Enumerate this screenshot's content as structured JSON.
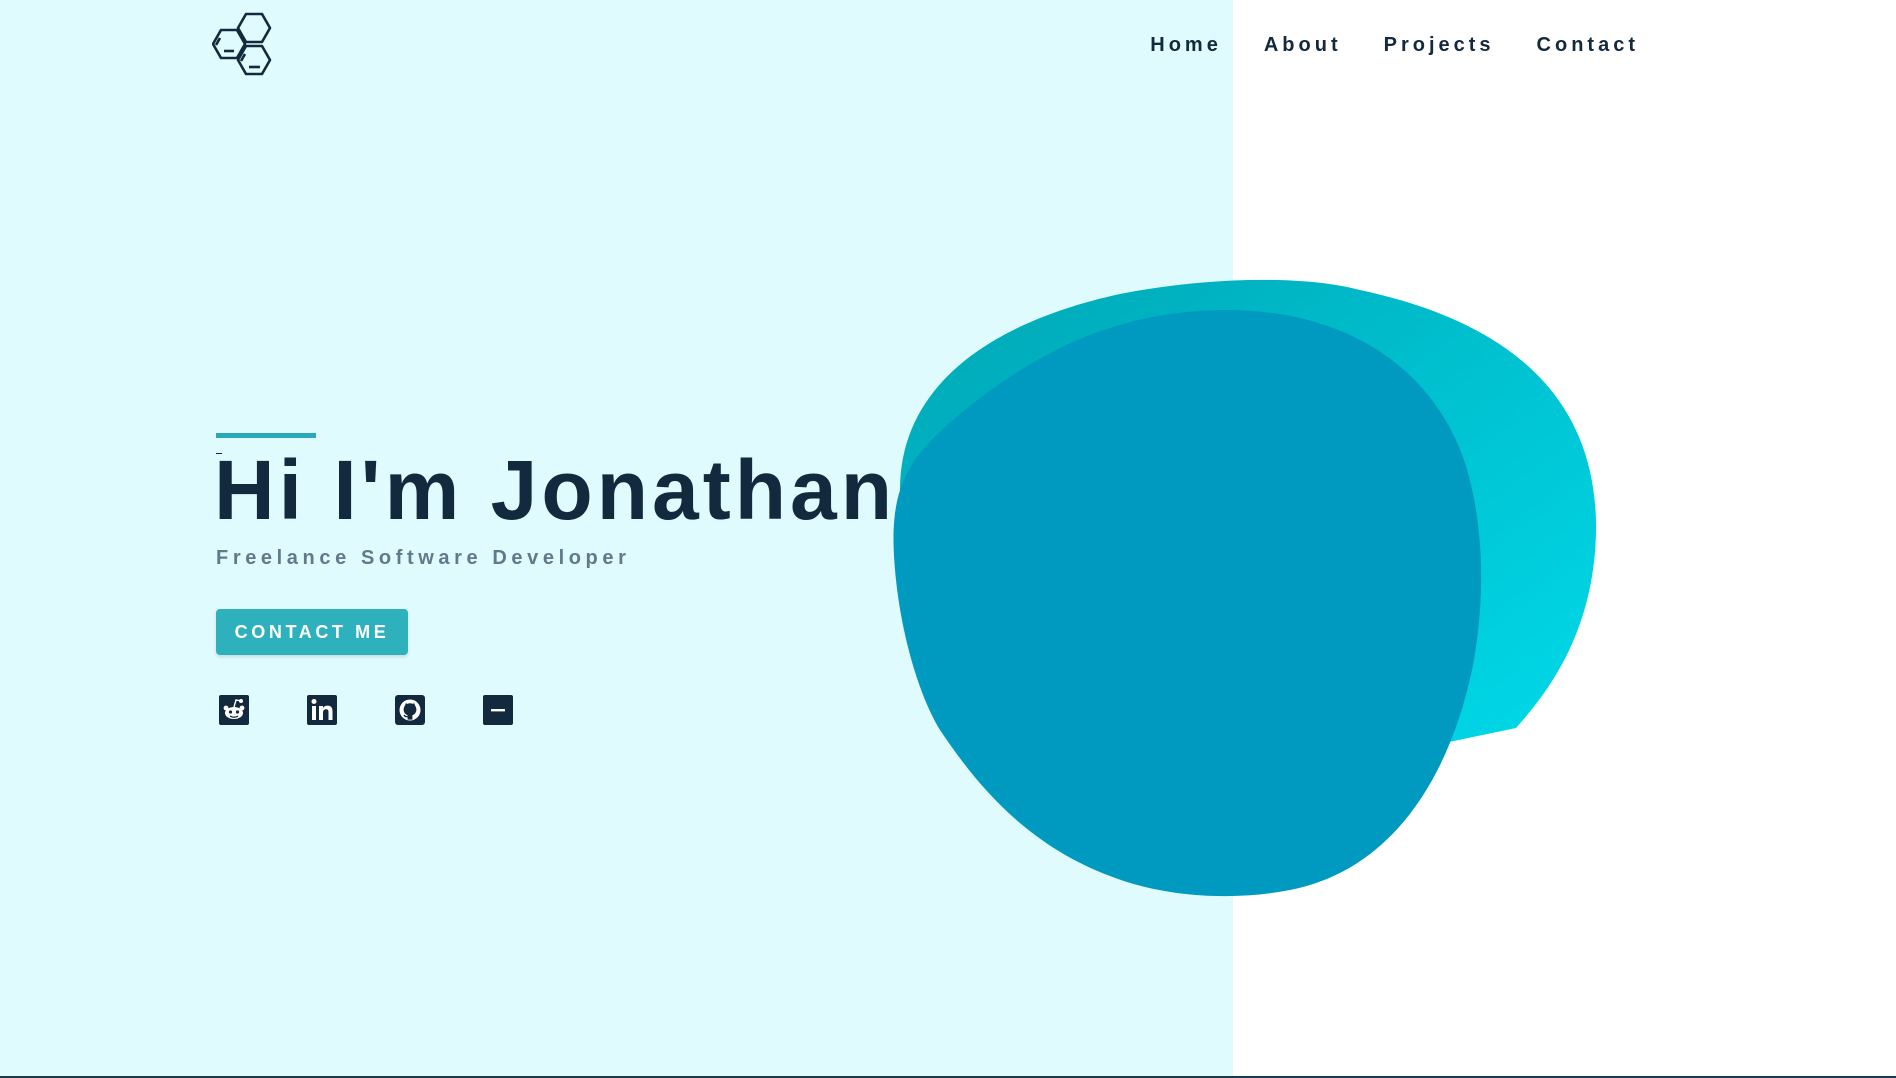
{
  "nav": {
    "items": [
      {
        "label": "Home"
      },
      {
        "label": "About"
      },
      {
        "label": "Projects"
      },
      {
        "label": "Contact"
      }
    ]
  },
  "hero": {
    "title": "Hi I'm Jonathan",
    "subtitle": "Freelance Software Developer",
    "cta_label": "CONTACT ME"
  },
  "socials": [
    {
      "icon": "reddit-icon"
    },
    {
      "icon": "linkedin-icon"
    },
    {
      "icon": "github-icon"
    },
    {
      "icon": "minus-square-icon"
    }
  ],
  "colors": {
    "left_background": "#e0fbfd",
    "text_dark": "#13293d",
    "subtitle": "#5e7b8c",
    "accent": "#2eb0bd",
    "blob_back": "#00c4d8",
    "blob_front": "#0099c0"
  }
}
